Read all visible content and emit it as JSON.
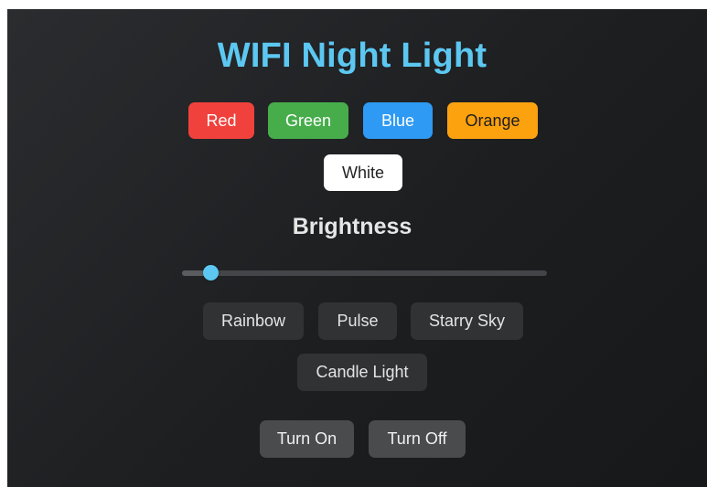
{
  "app": {
    "title": "WIFI Night Light"
  },
  "colors": {
    "buttons": [
      {
        "label": "Red",
        "color": "#f0413c"
      },
      {
        "label": "Green",
        "color": "#47ad4b"
      },
      {
        "label": "Blue",
        "color": "#2e9af3"
      },
      {
        "label": "Orange",
        "color": "#fca20f"
      },
      {
        "label": "White",
        "color": "#ffffff"
      }
    ]
  },
  "brightness": {
    "label": "Brightness",
    "value_fraction": 0.06,
    "accent": "#5cc8f2"
  },
  "effects": {
    "buttons": [
      {
        "label": "Rainbow"
      },
      {
        "label": "Pulse"
      },
      {
        "label": "Starry Sky"
      },
      {
        "label": "Candle Light"
      }
    ]
  },
  "power": {
    "on_label": "Turn On",
    "off_label": "Turn Off"
  }
}
